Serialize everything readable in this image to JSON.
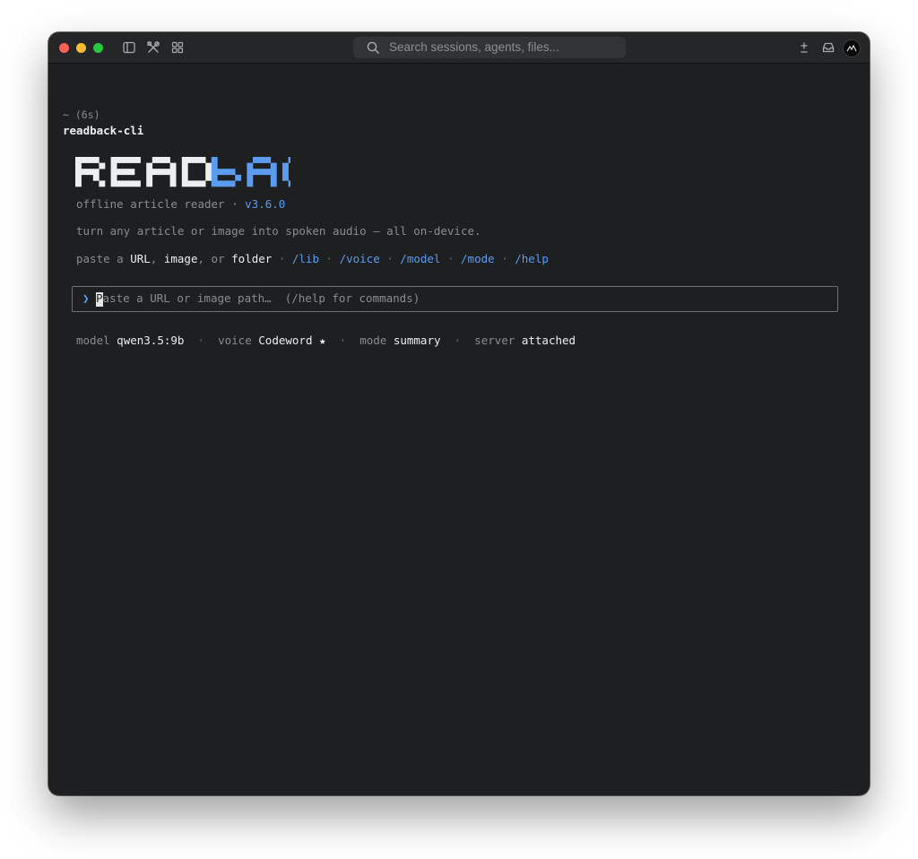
{
  "titlebar": {
    "search_placeholder": "Search sessions, agents, files...",
    "icons": [
      "sidebar-toggle-icon",
      "tools-icon",
      "grid-icon",
      "plus-minus-icon",
      "inbox-icon",
      "avatar"
    ]
  },
  "terminal": {
    "prompt": "~ (6s)",
    "cwd": "readback-cli",
    "logo": {
      "part1": "READ",
      "part2": "BACK"
    },
    "subtitle": "offline article reader",
    "subtitle_sep": " · ",
    "version": "v3.6.0",
    "tagline": "turn any article or image into spoken audio — all on-device.",
    "hint": {
      "prefix": "paste a ",
      "url": "URL",
      "comma1": ", ",
      "image": "image",
      "or": ", or ",
      "folder": "folder",
      "sep": " · ",
      "commands": [
        "/lib",
        "/voice",
        "/model",
        "/mode",
        "/help"
      ]
    },
    "input": {
      "chevron": "❯",
      "first_char": "P",
      "placeholder_rest": "aste a URL or image path…  (/help for commands)"
    },
    "status": {
      "model_label": "model",
      "model_value": "qwen3.5:9b",
      "voice_label": "voice",
      "voice_value": "Codeword ★",
      "mode_label": "mode",
      "mode_value": "summary",
      "server_label": "server",
      "server_value": "attached",
      "sep": "·"
    }
  },
  "colors": {
    "background": "#1e1f21",
    "accent": "#5b9cf0",
    "text_bright": "#eceef0",
    "text_dim": "#8a8c8f"
  }
}
